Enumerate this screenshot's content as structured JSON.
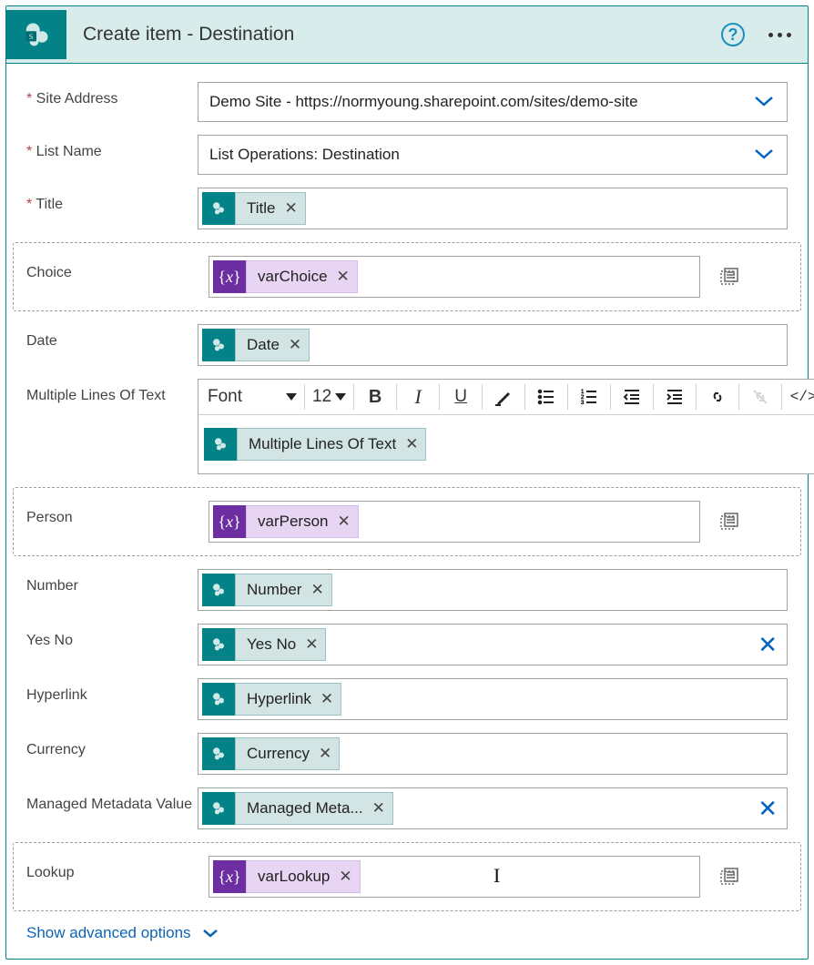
{
  "header": {
    "title": "Create item - Destination"
  },
  "fields": {
    "site_address": {
      "label": "Site Address",
      "value": "Demo Site - https://normyoung.sharepoint.com/sites/demo-site"
    },
    "list_name": {
      "label": "List Name",
      "value": "List Operations: Destination"
    },
    "title": {
      "label": "Title",
      "token": "Title"
    },
    "choice": {
      "label": "Choice",
      "token": "varChoice"
    },
    "date": {
      "label": "Date",
      "token": "Date"
    },
    "mlot": {
      "label": "Multiple Lines Of Text",
      "token": "Multiple Lines Of Text",
      "font": "Font",
      "size": "12"
    },
    "person": {
      "label": "Person",
      "token": "varPerson"
    },
    "number": {
      "label": "Number",
      "token": "Number"
    },
    "yesno": {
      "label": "Yes No",
      "token": "Yes No"
    },
    "hyperlink": {
      "label": "Hyperlink",
      "token": "Hyperlink"
    },
    "currency": {
      "label": "Currency",
      "token": "Currency"
    },
    "metadata": {
      "label": "Managed Metadata Value",
      "token": "Managed Meta..."
    },
    "lookup": {
      "label": "Lookup",
      "token": "varLookup"
    }
  },
  "footer": {
    "advanced": "Show advanced options"
  }
}
